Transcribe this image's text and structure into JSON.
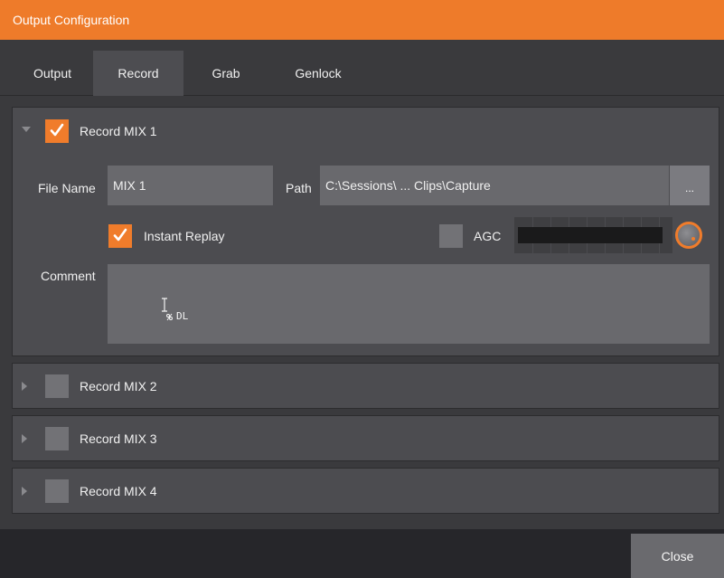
{
  "window": {
    "title": "Output Configuration"
  },
  "tabs": [
    {
      "label": "Output",
      "active": false
    },
    {
      "label": "Record",
      "active": true
    },
    {
      "label": "Grab",
      "active": false
    },
    {
      "label": "Genlock",
      "active": false
    }
  ],
  "records": [
    {
      "label": "Record MIX 1",
      "expanded": true,
      "checked": true,
      "file_name_label": "File Name",
      "file_name_value": "MIX 1",
      "path_label": "Path",
      "path_value": "C:\\Sessions\\ ... Clips\\Capture",
      "browse_label": "...",
      "instant_replay_label": "Instant Replay",
      "instant_replay_checked": true,
      "agc_label": "AGC",
      "agc_checked": false,
      "comment_label": "Comment",
      "comment_value": "",
      "cursor_tag": "DL"
    },
    {
      "label": "Record MIX 2",
      "expanded": false,
      "checked": false
    },
    {
      "label": "Record MIX 3",
      "expanded": false,
      "checked": false
    },
    {
      "label": "Record MIX 4",
      "expanded": false,
      "checked": false
    }
  ],
  "footer": {
    "close_label": "Close"
  },
  "colors": {
    "accent": "#f07c2b",
    "background": "#3a3a3d",
    "panel": "#4c4c50",
    "field": "#69696d"
  },
  "icons": [
    "checkmark-icon",
    "expand-arrow-icon",
    "collapse-arrow-icon",
    "text-cursor-icon",
    "volume-knob-icon"
  ]
}
